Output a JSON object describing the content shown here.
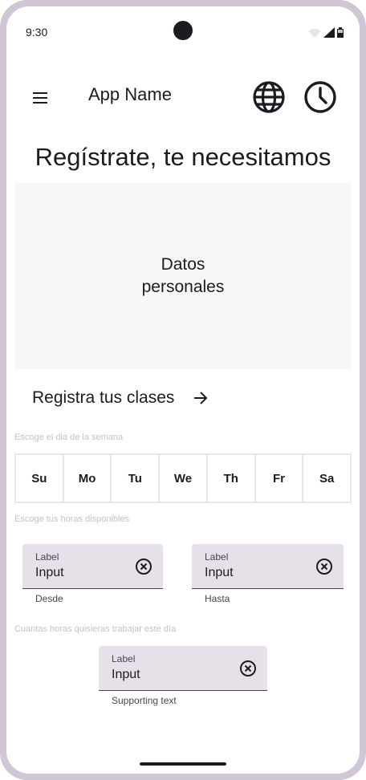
{
  "status_bar": {
    "time": "9:30"
  },
  "app_bar": {
    "title": "App Name"
  },
  "page_title": "Regístrate, te necesitamos",
  "personal_card": {
    "line1": "Datos",
    "line2": "personales"
  },
  "classes_link": {
    "label": "Registra tus clases"
  },
  "day_section": {
    "caption": "Escoge el dia de la semana",
    "days": [
      "Su",
      "Mo",
      "Tu",
      "We",
      "Th",
      "Fr",
      "Sa"
    ]
  },
  "hours_section": {
    "caption": "Escoge tus horas disponibles",
    "from": {
      "label": "Label",
      "value": "Input",
      "support": "Desde"
    },
    "to": {
      "label": "Label",
      "value": "Input",
      "support": "Hasta"
    }
  },
  "amount_section": {
    "caption": "Cuantas horas quisieras trabajar este día",
    "field": {
      "label": "Label",
      "value": "Input",
      "support": "Supporting text"
    }
  },
  "icons": {
    "menu": "menu-icon",
    "language": "globe-icon",
    "history": "clock-icon",
    "arrow": "arrow-right-icon",
    "clear": "cancel-icon"
  },
  "colors": {
    "field_bg": "#e6e0e9",
    "card_bg": "#f7f7f7",
    "frame": "#cfc6d6",
    "text": "#1d1b20"
  }
}
